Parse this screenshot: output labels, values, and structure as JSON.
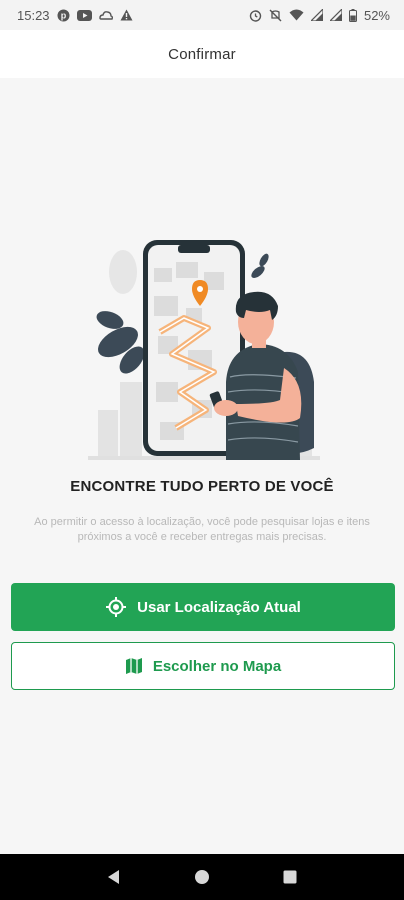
{
  "status_bar": {
    "time": "15:23",
    "battery": "52%",
    "left_icons": [
      "pinterest-icon",
      "youtube-icon",
      "cloud-icon",
      "warning-icon"
    ],
    "right_icons": [
      "alarm-icon",
      "mute-icon",
      "wifi-icon",
      "signal-icon",
      "signal-icon",
      "battery-icon"
    ]
  },
  "app_bar": {
    "title": "Confirmar"
  },
  "content": {
    "headline": "ENCONTRE TUDO PERTO DE VOCÊ",
    "description": "Ao permitir o acesso à localização, você pode pesquisar lojas e itens próximos a você e receber entregas mais precisas."
  },
  "buttons": {
    "use_location": {
      "label": "Usar Localização Atual",
      "icon": "location-target-icon"
    },
    "choose_map": {
      "label": "Escolher no Mapa",
      "icon": "map-icon"
    }
  },
  "colors": {
    "primary": "#22a455",
    "accent_pin": "#f08a24",
    "text_dark": "#222222",
    "text_muted": "#b8b8b8"
  },
  "nav_bar": {
    "items": [
      "back-icon",
      "home-icon",
      "recents-icon"
    ]
  }
}
